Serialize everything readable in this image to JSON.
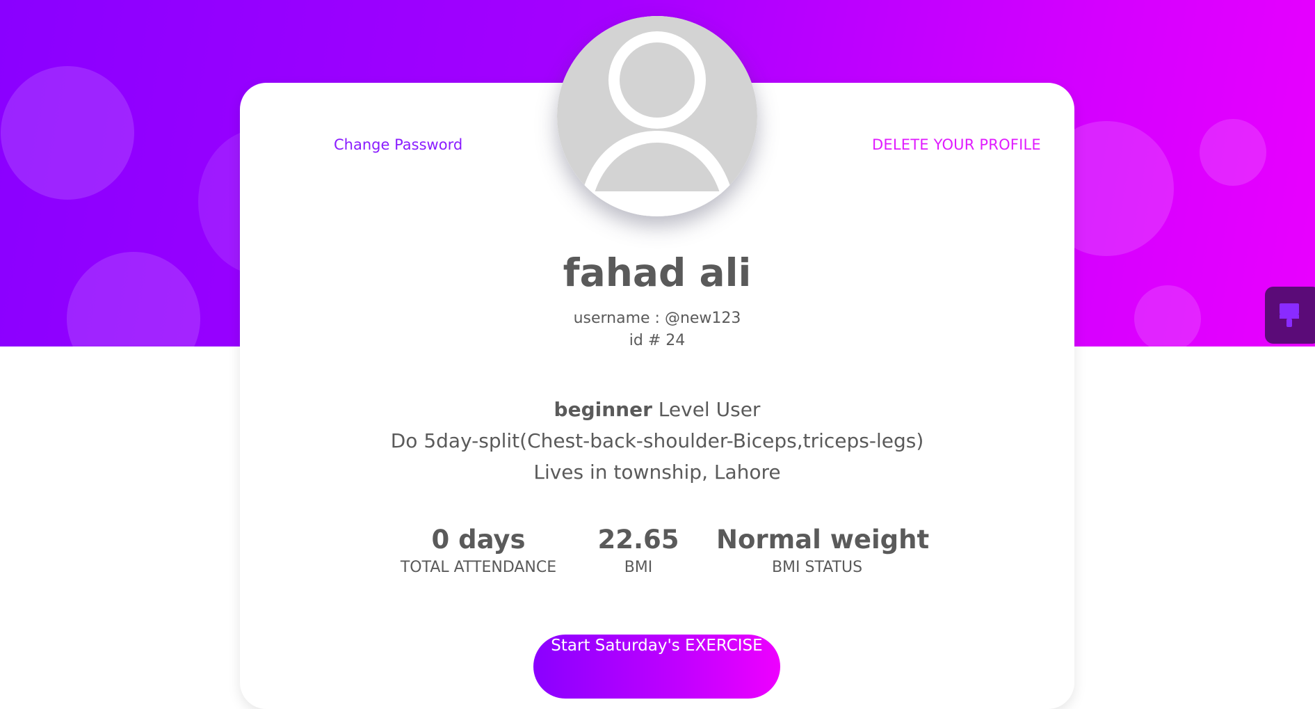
{
  "profile": {
    "name": "fahad ali",
    "username": "username : @new123",
    "id": "id # 24",
    "level": "beginner",
    "level_suffix": "Level User",
    "plan": "Do 5day-split(Chest-back-shoulder-Biceps,triceps-legs)",
    "lives": "Lives in township, Lahore"
  },
  "actions": {
    "change_password": "Change Password",
    "delete_profile": "DELETE YOUR PROFILE",
    "start_exercise": "Start Saturday's EXERCISE"
  },
  "stats": [
    {
      "value": "0 days",
      "label": "TOTAL ATTENDANCE"
    },
    {
      "value": "22.65",
      "label": "BMI"
    },
    {
      "value": "Normal weight",
      "label": "BMI STATUS"
    }
  ],
  "icons": {
    "avatar": "user-placeholder-icon",
    "side_widget": "paint-brush-icon"
  },
  "colors": {
    "gradient_start": "#8a00ff",
    "gradient_end": "#e900ff",
    "change_password_link": "#8a1cff",
    "delete_profile_link": "#e01bff",
    "widget_bg": "#5b0b78"
  }
}
